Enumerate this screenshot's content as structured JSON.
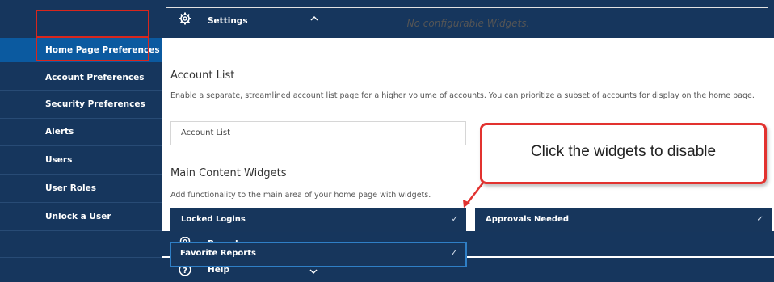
{
  "sidebar": {
    "settings_label": "Settings",
    "items": [
      {
        "label": "Home Page Preferences",
        "active": true
      },
      {
        "label": "Account Preferences"
      },
      {
        "label": "Security Preferences"
      },
      {
        "label": "Alerts"
      },
      {
        "label": "Users"
      },
      {
        "label": "User Roles"
      },
      {
        "label": "Unlock a User"
      }
    ],
    "branches_label": "Branches",
    "help_label": "Help",
    "icons": {
      "settings": "gear-icon",
      "branches": "location-pin-icon",
      "help": "question-circle-icon",
      "collapse": "chevron-up-icon",
      "expand": "chevron-down-icon"
    }
  },
  "main": {
    "no_widgets_text": "No configurable Widgets.",
    "account_list": {
      "title": "Account List",
      "description": "Enable a separate, streamlined account list page for a higher volume of accounts. You can prioritize a subset of accounts for display on the home page.",
      "input_value": "Account List"
    },
    "main_content": {
      "title": "Main Content Widgets",
      "description": "Add functionality to the main area of your home page with widgets.",
      "widgets": [
        {
          "label": "Locked Logins",
          "check": "✓"
        },
        {
          "label": "Approvals Needed",
          "check": "✓"
        },
        {
          "label": "Favorite Reports",
          "check": "✓"
        }
      ]
    }
  },
  "callout": {
    "text": "Click the widgets to disable"
  },
  "colors": {
    "sidebar_bg": "#16365d",
    "active_item_bg": "#0b5aa0",
    "widget_bg": "#17365c",
    "highlight_red": "#d9261c"
  }
}
